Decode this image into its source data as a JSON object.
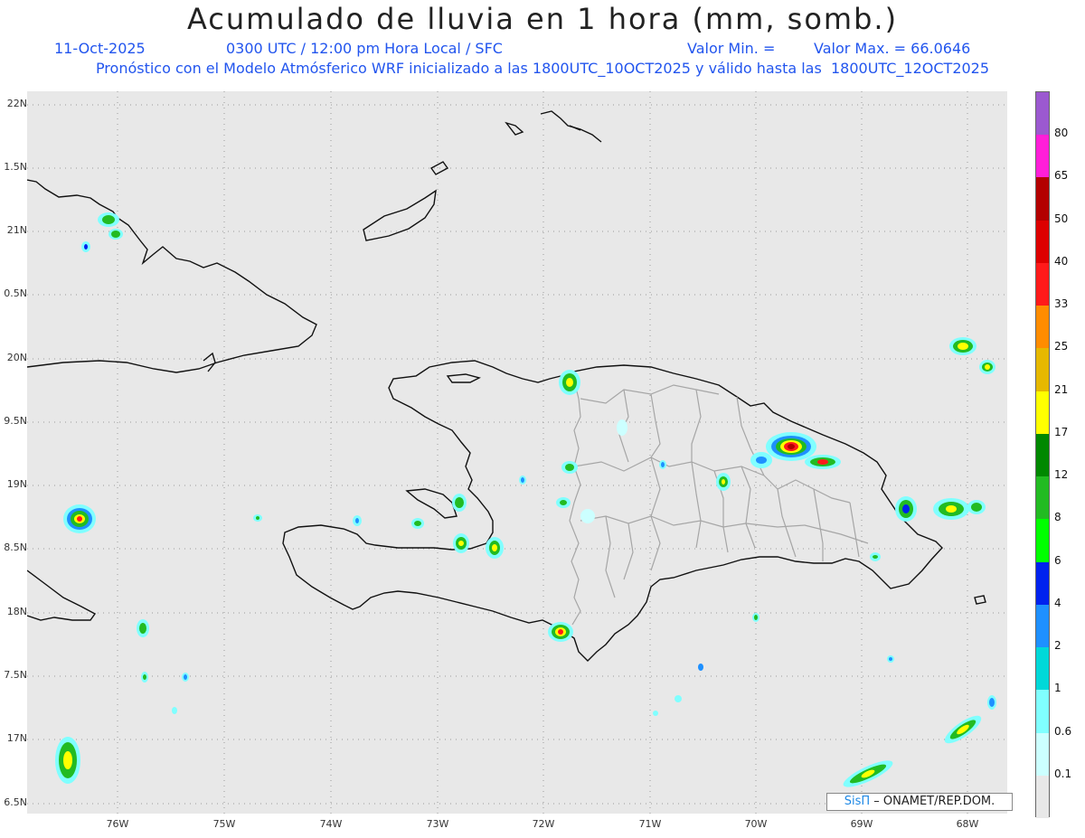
{
  "header": {
    "title": "Acumulado de lluvia en 1 hora (mm, somb.)",
    "date": "11-Oct-2025",
    "time": "0300 UTC / 12:00 pm Hora Local / SFC",
    "min": "Valor Min. =",
    "max": "Valor Max. = 66.0646",
    "forecast": "Pronóstico con el Modelo Atmósferico WRF inicializado a las 1800UTC_10OCT2025 y válido hasta las  1800UTC_12OCT2025"
  },
  "axes": {
    "lat_labels": [
      "22N",
      "1.5N",
      "21N",
      "0.5N",
      "20N",
      "9.5N",
      "19N",
      "8.5N",
      "18N",
      "7.5N",
      "17N",
      "6.5N"
    ],
    "lon_labels": [
      "76W",
      "75W",
      "74W",
      "73W",
      "72W",
      "71W",
      "70W",
      "69W",
      "68W"
    ]
  },
  "colorbar": {
    "labels": [
      "80",
      "65",
      "50",
      "40",
      "33",
      "25",
      "21",
      "17",
      "12",
      "8",
      "6",
      "4",
      "2",
      "1",
      "0.6",
      "0.1"
    ],
    "colors": [
      "#9b59d0",
      "#ff1ed8",
      "#b30000",
      "#dd0000",
      "#ff1a1a",
      "#ff8c00",
      "#e6b800",
      "#ffff00",
      "#008800",
      "#22bb22",
      "#00ff00",
      "#0022ee",
      "#1e90ff",
      "#00d8d8",
      "#80ffff",
      "#ccffff",
      "#e8e8e8"
    ]
  },
  "credit": {
    "brand": "SisΠ",
    "org": "– ONAMET/REP.DOM."
  }
}
